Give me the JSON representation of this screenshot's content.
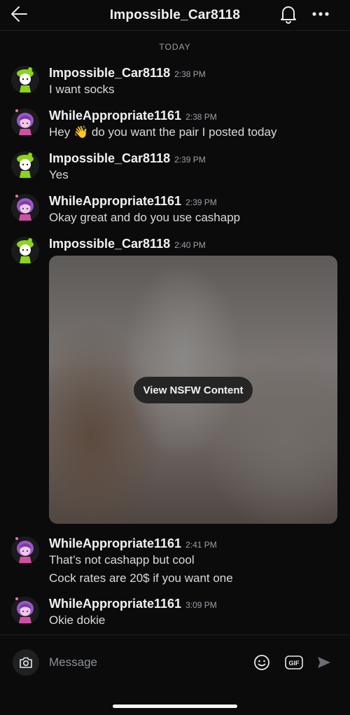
{
  "header": {
    "title": "Impossible_Car8118",
    "back_icon": "arrow-left-icon",
    "bell_icon": "bell-icon",
    "more_icon": "ellipsis-icon"
  },
  "divider": {
    "label": "TODAY"
  },
  "messages": [
    {
      "user": "Impossible_Car8118",
      "time": "2:38 PM",
      "lines": [
        "I want socks"
      ],
      "avatar": "green-hat-avatar"
    },
    {
      "user": "WhileAppropriate1161",
      "time": "2:38 PM",
      "lines": [
        "Hey 👋 do you want the pair I posted today"
      ],
      "avatar": "purple-hair-avatar"
    },
    {
      "user": "Impossible_Car8118",
      "time": "2:39 PM",
      "lines": [
        "Yes"
      ],
      "avatar": "green-hat-avatar"
    },
    {
      "user": "WhileAppropriate1161",
      "time": "2:39 PM",
      "lines": [
        "Okay great and do you use cashapp"
      ],
      "avatar": "purple-hair-avatar"
    },
    {
      "user": "Impossible_Car8118",
      "time": "2:40 PM",
      "lines": [],
      "avatar": "green-hat-avatar",
      "attachment": {
        "button_label": "View NSFW Content"
      }
    },
    {
      "user": "WhileAppropriate1161",
      "time": "2:41 PM",
      "lines": [
        "That’s not cashapp but cool",
        "Cock rates are 20$ if you want one"
      ],
      "avatar": "purple-hair-avatar"
    },
    {
      "user": "WhileAppropriate1161",
      "time": "3:09 PM",
      "lines": [
        "Okie dokie"
      ],
      "avatar": "purple-hair-avatar"
    }
  ],
  "composer": {
    "placeholder": "Message",
    "camera_icon": "camera-icon",
    "emoji_icon": "emoji-icon",
    "gif_label": "GIF",
    "send_icon": "send-icon"
  },
  "colors": {
    "background": "#0b0b0c",
    "green_avatar": "#8bd41c",
    "purple_avatar": "#9b57c6"
  }
}
